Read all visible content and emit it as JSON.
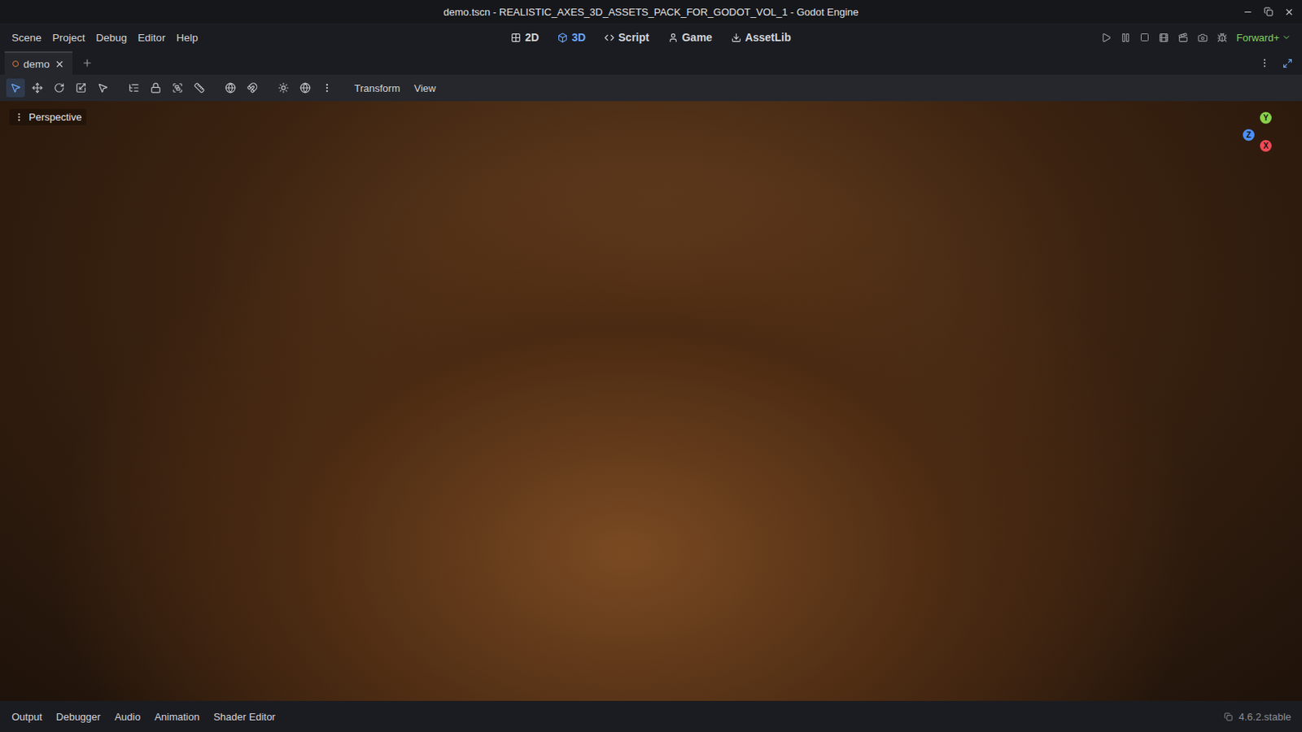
{
  "window": {
    "title": "demo.tscn - REALISTIC_AXES_3D_ASSETS_PACK_FOR_GODOT_VOL_1 - Godot Engine"
  },
  "menu": [
    "Scene",
    "Project",
    "Debug",
    "Editor",
    "Help"
  ],
  "workspaces": [
    {
      "label": "2D",
      "selected": false,
      "icon": "2d"
    },
    {
      "label": "3D",
      "selected": true,
      "icon": "3d"
    },
    {
      "label": "Script",
      "selected": false,
      "icon": "script"
    },
    {
      "label": "Game",
      "selected": false,
      "icon": "game"
    },
    {
      "label": "AssetLib",
      "selected": false,
      "icon": "assetlib"
    }
  ],
  "renderer": "Forward+",
  "scene_tabs": [
    {
      "label": "demo",
      "selected": true
    }
  ],
  "toolbar": {
    "tools": [
      {
        "tool": "select",
        "selected": true
      },
      {
        "tool": "move",
        "selected": false
      },
      {
        "tool": "rotate",
        "selected": false
      },
      {
        "tool": "scale",
        "selected": false
      },
      {
        "tool": "pointer",
        "selected": false
      },
      {
        "tool": "list",
        "selected": false
      },
      {
        "tool": "lock",
        "selected": false
      },
      {
        "tool": "group",
        "selected": false
      },
      {
        "tool": "ruler",
        "selected": false
      },
      {
        "tool": "local",
        "selected": false
      },
      {
        "tool": "snap",
        "selected": false
      },
      {
        "tool": "sun",
        "selected": false
      },
      {
        "tool": "environment",
        "selected": false
      },
      {
        "tool": "more",
        "selected": false
      }
    ],
    "menus": [
      "Transform",
      "View"
    ]
  },
  "viewport": {
    "label": "Perspective",
    "gizmo_axes": [
      {
        "label": "Y",
        "color": "#8ad14a"
      },
      {
        "label": "Z",
        "color": "#4d8ff5"
      },
      {
        "label": "X",
        "color": "#f04a55"
      }
    ]
  },
  "bottom_panel": {
    "tabs": [
      "Output",
      "Debugger",
      "Audio",
      "Animation",
      "Shader Editor"
    ],
    "version": "4.6.2.stable"
  }
}
